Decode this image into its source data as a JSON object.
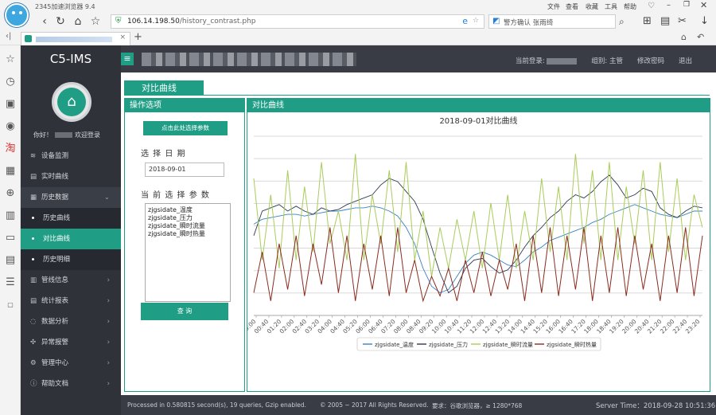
{
  "browser": {
    "title": "2345加速浏览器 9.4",
    "url_host": "106.14.198.50",
    "url_path": "/history_contrast.php",
    "search_text": "警方确认 张雨绮",
    "menu": [
      "文件",
      "查看",
      "收藏",
      "工具",
      "帮助"
    ]
  },
  "app": {
    "brand": "C5-IMS",
    "header": {
      "current_login_label": "当前登录:",
      "group_label": "组别: 主管",
      "change_password": "修改密码",
      "logout": "退出"
    },
    "sidebar": {
      "greeting_prefix": "你好！",
      "greeting_suffix": "欢迎登录",
      "items": [
        {
          "label": "设备监测",
          "icon": "layers-icon"
        },
        {
          "label": "实时曲线",
          "icon": "chart-icon"
        },
        {
          "label": "历史数据",
          "icon": "calendar-icon"
        },
        {
          "label": "管线信息",
          "icon": "pipe-icon"
        },
        {
          "label": "统计报表",
          "icon": "report-icon"
        },
        {
          "label": "数据分析",
          "icon": "analysis-icon"
        },
        {
          "label": "异常报警",
          "icon": "alarm-icon"
        },
        {
          "label": "管理中心",
          "icon": "gear-icon"
        },
        {
          "label": "帮助文档",
          "icon": "help-icon"
        }
      ],
      "history_sub": [
        "历史曲线",
        "对比曲线",
        "历史明细"
      ]
    },
    "page_title": "对比曲线",
    "ops": {
      "header": "操作选项",
      "select_button": "点击此处选择参数",
      "date_label": "选 择 日 期",
      "date_value": "2018-09-01",
      "params_label": "当 前 选 择 参 数",
      "params": [
        "zjgsidate_温度",
        "zjgsidate_压力",
        "zjgsidate_瞬时流量",
        "zjgsidate_瞬时热量"
      ],
      "query_button": "查 询"
    },
    "chart_panel_header": "对比曲线",
    "footer": {
      "processed": "Processed in 0.580815 second(s), 19 queries, Gzip enabled.",
      "copyright": "© 2005 ~ 2017 All Rights Reserved.",
      "requirement": "要求：谷歌浏览器，≥ 1280*768",
      "server_time": "Server Time：2018-09-28 10:51:36"
    }
  },
  "chart_data": {
    "type": "line",
    "title": "2018-09-01对比曲线",
    "x_tick_labels": [
      "00:00",
      "00:40",
      "01:20",
      "02:00",
      "02:40",
      "03:20",
      "04:00",
      "04:40",
      "05:20",
      "06:00",
      "06:40",
      "07:20",
      "08:00",
      "08:40",
      "09:20",
      "10:00",
      "10:40",
      "11:20",
      "12:00",
      "12:40",
      "13:20",
      "14:00",
      "14:40",
      "15:20",
      "16:00",
      "16:40",
      "17:20",
      "18:00",
      "18:40",
      "19:20",
      "20:00",
      "20:40",
      "21:20",
      "22:00",
      "22:40",
      "23:20"
    ],
    "grid": true,
    "legend_position": "bottom",
    "series": [
      {
        "name": "zjgsidate_温度",
        "color": "#3a82c4",
        "values": [
          0.52,
          0.55,
          0.56,
          0.57,
          0.58,
          0.58,
          0.57,
          0.58,
          0.59,
          0.6,
          0.6,
          0.61,
          0.62,
          0.62,
          0.63,
          0.62,
          0.6,
          0.57,
          0.5,
          0.4,
          0.25,
          0.14,
          0.1,
          0.12,
          0.2,
          0.28,
          0.33,
          0.35,
          0.33,
          0.3,
          0.27,
          0.26,
          0.3,
          0.35,
          0.38,
          0.42,
          0.44,
          0.46,
          0.48,
          0.5,
          0.53,
          0.55,
          0.58,
          0.6,
          0.62,
          0.64,
          0.62,
          0.6,
          0.58,
          0.57,
          0.56,
          0.58,
          0.6,
          0.6
        ]
      },
      {
        "name": "zjgsidate_压力",
        "color": "#2e3a55",
        "values": [
          0.45,
          0.6,
          0.62,
          0.64,
          0.6,
          0.63,
          0.6,
          0.58,
          0.62,
          0.6,
          0.61,
          0.64,
          0.66,
          0.68,
          0.7,
          0.76,
          0.8,
          0.78,
          0.72,
          0.66,
          0.55,
          0.38,
          0.22,
          0.1,
          0.14,
          0.25,
          0.3,
          0.31,
          0.26,
          0.22,
          0.24,
          0.3,
          0.38,
          0.45,
          0.5,
          0.56,
          0.6,
          0.66,
          0.7,
          0.68,
          0.72,
          0.78,
          0.82,
          0.76,
          0.68,
          0.7,
          0.74,
          0.72,
          0.62,
          0.58,
          0.56,
          0.6,
          0.63,
          0.62
        ]
      },
      {
        "name": "zjgsidate_瞬时流量",
        "color": "#a9cc5a",
        "values": [
          0.8,
          0.3,
          0.7,
          0.25,
          0.85,
          0.3,
          0.75,
          0.35,
          0.9,
          0.4,
          0.6,
          0.3,
          0.95,
          0.3,
          0.7,
          0.4,
          0.85,
          0.35,
          0.9,
          0.3,
          0.6,
          0.2,
          0.5,
          0.25,
          0.55,
          0.3,
          0.6,
          0.25,
          0.65,
          0.3,
          0.7,
          0.25,
          0.6,
          0.3,
          0.8,
          0.35,
          0.75,
          0.3,
          0.95,
          0.4,
          0.85,
          0.3,
          0.9,
          0.3,
          0.75,
          0.4,
          0.85,
          0.3,
          0.9,
          0.35,
          0.8,
          0.3,
          0.7,
          0.5
        ]
      },
      {
        "name": "zjgsidate_瞬时热量",
        "color": "#8a2b1e",
        "values": [
          0.1,
          0.35,
          0.05,
          0.4,
          0.12,
          0.45,
          0.08,
          0.4,
          0.15,
          0.5,
          0.1,
          0.45,
          0.05,
          0.4,
          0.12,
          0.45,
          0.08,
          0.5,
          0.1,
          0.3,
          0.05,
          0.2,
          0.08,
          0.25,
          0.05,
          0.3,
          0.1,
          0.35,
          0.08,
          0.3,
          0.12,
          0.4,
          0.05,
          0.45,
          0.1,
          0.5,
          0.08,
          0.45,
          0.12,
          0.5,
          0.05,
          0.45,
          0.1,
          0.5,
          0.08,
          0.45,
          0.12,
          0.4,
          0.05,
          0.45,
          0.1,
          0.5,
          0.08,
          0.45
        ]
      }
    ]
  }
}
